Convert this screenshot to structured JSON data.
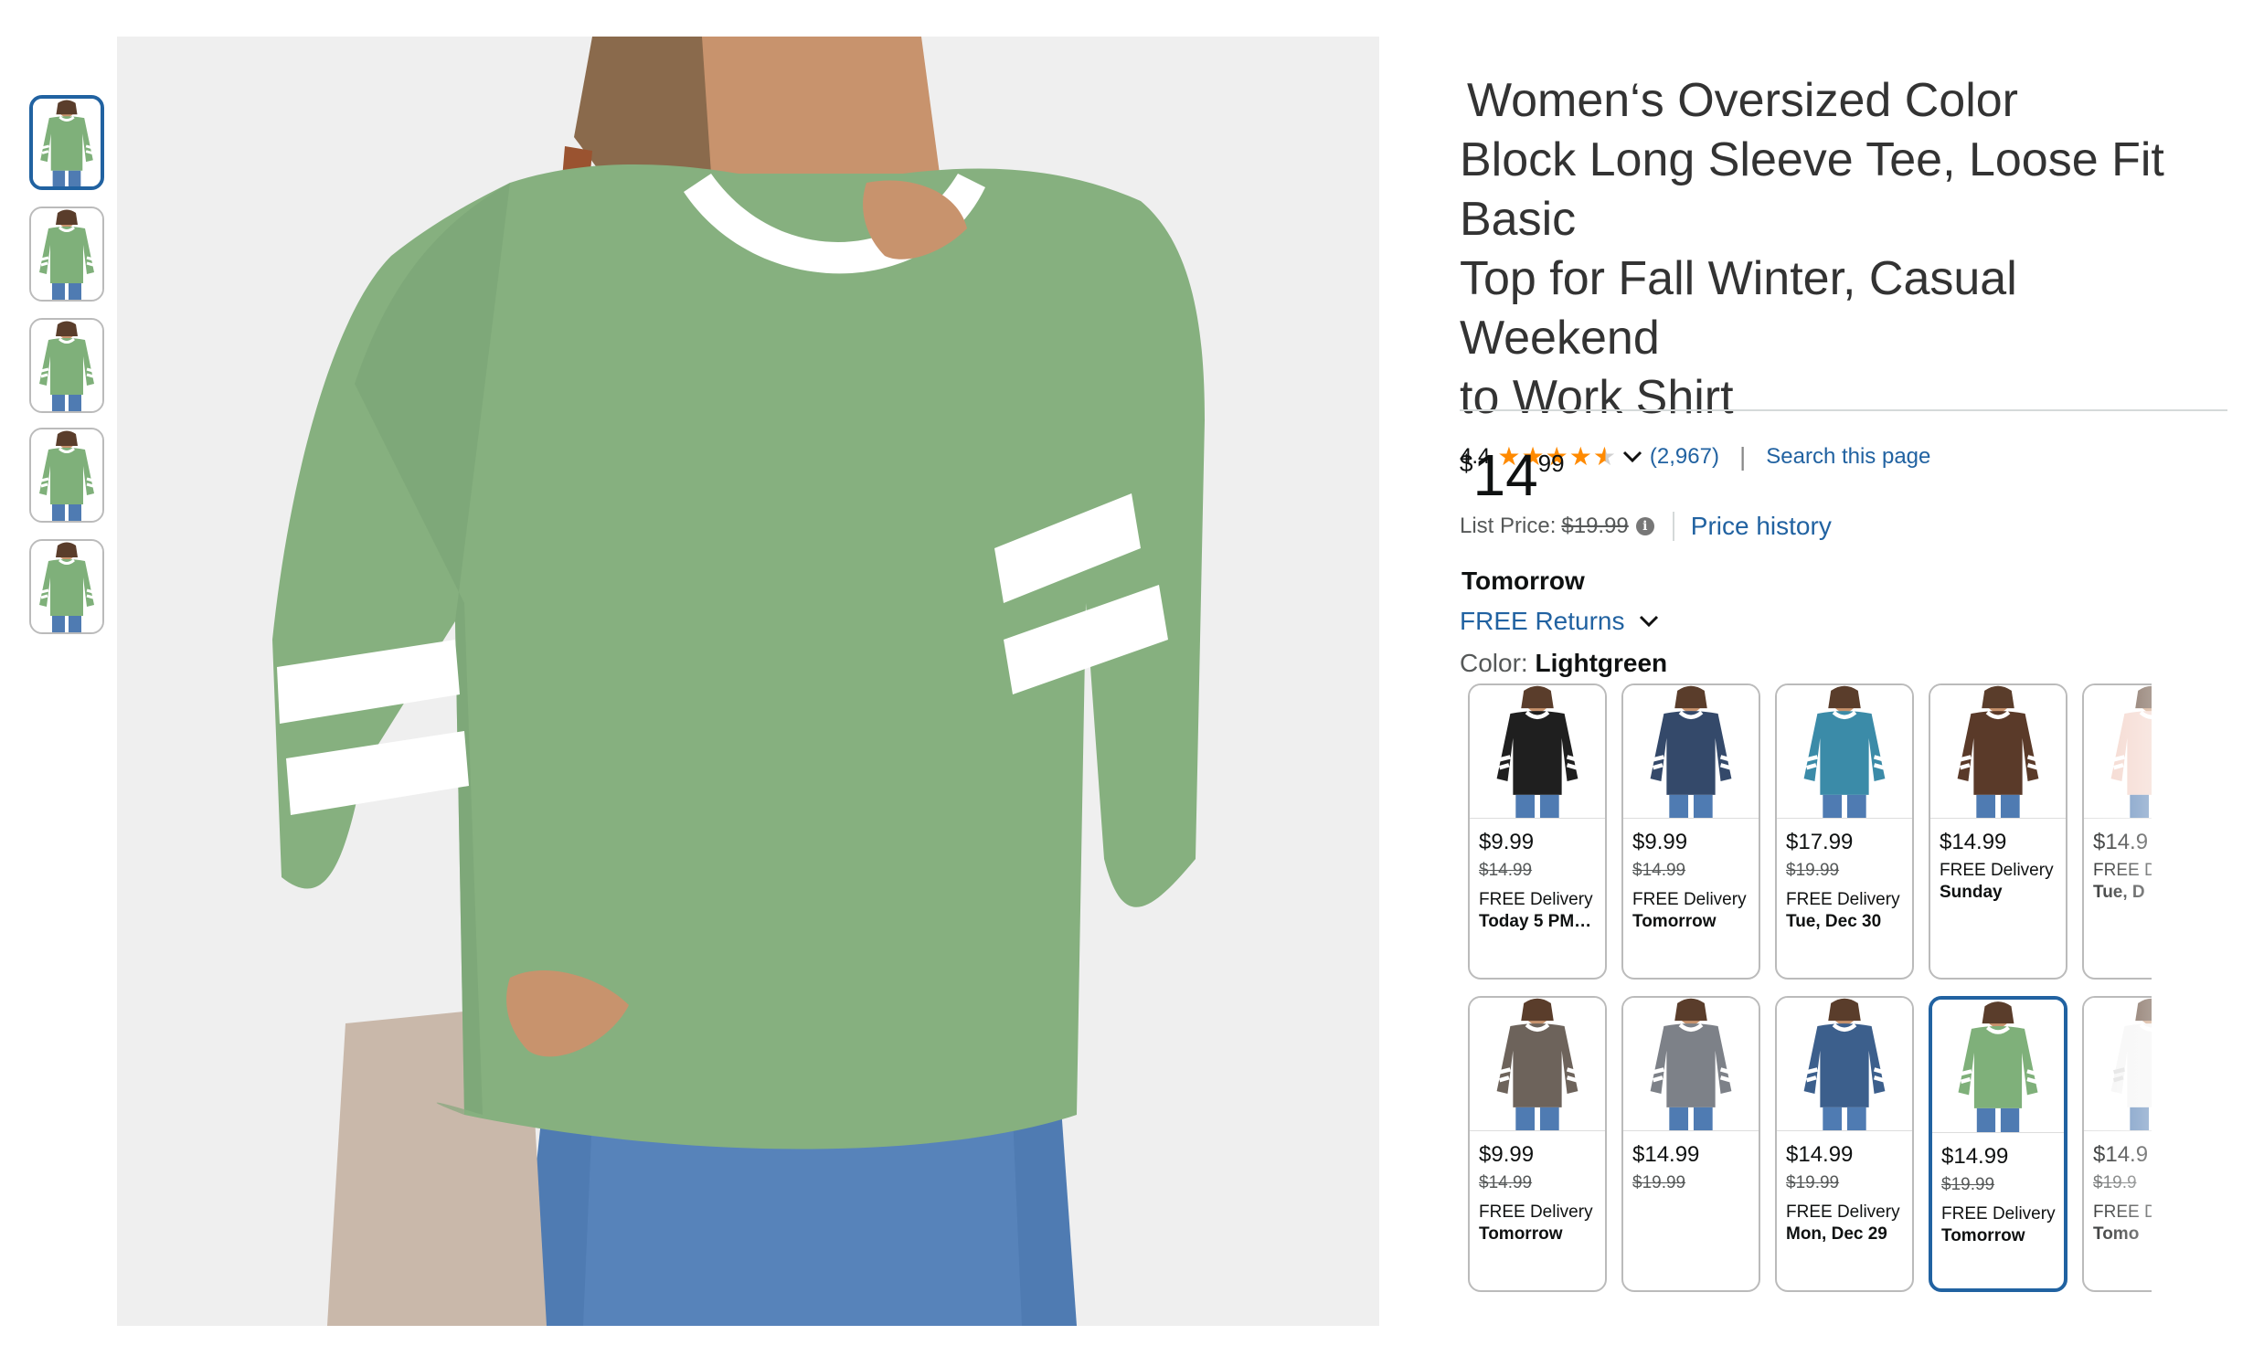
{
  "product": {
    "title_line1": "Women‘s Oversized Color",
    "title_line2": "Block Long Sleeve Tee, Loose Fit Basic",
    "title_line3": "Top for Fall Winter, Casual Weekend",
    "title_line4": "to Work Shirt",
    "rating": "4.4",
    "rating_stars": 4.4,
    "review_count": "(2,967)",
    "search_link": "Search this page"
  },
  "price": {
    "currency": "$",
    "whole": "14",
    "fraction": "99",
    "list_label": "List Price:",
    "list_value": "$19.99",
    "history_link": "Price history"
  },
  "delivery": {
    "day": "Tomorrow",
    "returns": "FREE Returns"
  },
  "color": {
    "label": "Color:",
    "selected": "Lightgreen"
  },
  "swatches": [
    {
      "color": "#1f1f1f",
      "price": "$9.99",
      "was": "$14.99",
      "line1": "FREE Delivery",
      "line2": "Today 5 PM…"
    },
    {
      "color": "#34496a",
      "price": "$9.99",
      "was": "$14.99",
      "line1": "FREE Delivery",
      "line2": "Tomorrow"
    },
    {
      "color": "#3b8ba8",
      "price": "$17.99",
      "was": "$19.99",
      "line1": "FREE Delivery",
      "line2": "Tue, Dec 30"
    },
    {
      "color": "#5a3a29",
      "price": "$14.99",
      "was": "",
      "line1": "FREE Delivery",
      "line2": "Sunday"
    },
    {
      "color": "#f2cfc4",
      "price": "$14.9",
      "was": "",
      "line1": "FREE D",
      "line2": "Tue, D"
    },
    {
      "color": "#6d635b",
      "price": "$9.99",
      "was": "$14.99",
      "line1": "FREE Delivery",
      "line2": "Tomorrow"
    },
    {
      "color": "#7d8188",
      "price": "$14.99",
      "was": "$19.99",
      "line1": "",
      "line2": ""
    },
    {
      "color": "#3c5f8c",
      "price": "$14.99",
      "was": "$19.99",
      "line1": "FREE Delivery",
      "line2": "Mon, Dec 29"
    },
    {
      "color": "#7fb07a",
      "price": "$14.99",
      "was": "$19.99",
      "line1": "FREE Delivery",
      "line2": "Tomorrow"
    },
    {
      "color": "#f4f4f4",
      "price": "$14.9",
      "was": "$19.9",
      "line1": "FREE D",
      "line2": "Tomo"
    }
  ],
  "selected_swatch_index": 8,
  "thumbnails": [
    {
      "shirt": "#7fb07a",
      "selected": true
    },
    {
      "shirt": "#7fb07a",
      "selected": false
    },
    {
      "shirt": "#7fb07a",
      "selected": false
    },
    {
      "shirt": "#7fb07a",
      "selected": false
    },
    {
      "shirt": "#7fb07a",
      "selected": false
    }
  ],
  "colors": {
    "accent_link": "#2162a1",
    "star": "#ff8a00",
    "shirt_main": "#86b07f",
    "selected_border": "#2162a1"
  },
  "icons": {
    "share": "share-icon",
    "info": "info-icon",
    "chevron": "chevron-down-icon",
    "star": "star-icon"
  }
}
